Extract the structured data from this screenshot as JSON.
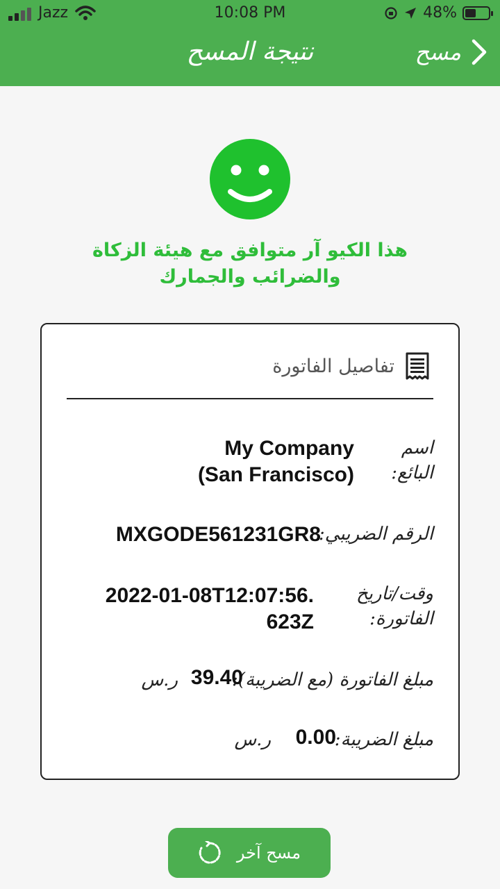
{
  "status_bar": {
    "carrier": "Jazz",
    "time": "10:08 PM",
    "battery": "48%",
    "battery_level": 0.48
  },
  "header": {
    "title": "نتيجة المسح",
    "back_label": "مسح"
  },
  "result": {
    "message_line1": "هذا الكيو آر متوافق مع هيئة الزكاة",
    "message_line2": "والضرائب والجمارك"
  },
  "invoice": {
    "section_title": "تفاصيل الفاتورة",
    "seller_label": "اسم البائع:",
    "seller_value_line1": "My Company",
    "seller_value_line2": "(San Francisco)",
    "tax_number_label": "الرقم الضريبي:",
    "tax_number_value": "MXGODE561231GR8",
    "datetime_label_line1": "وقت/تاريخ",
    "datetime_label_line2": "الفاتورة:",
    "datetime_value_line1": "2022-01-08T12:07:56.",
    "datetime_value_line2": "623Z",
    "amount_label": "مبلغ الفاتورة (مع الضريبة):",
    "amount_value": "39.40",
    "amount_currency": "ر.س",
    "tax_label": "مبلغ الضريبة:",
    "tax_value": "0.00",
    "tax_currency": "ر.س"
  },
  "actions": {
    "scan_again_label": "مسح آخر"
  },
  "colors": {
    "header_green": "#4caf50",
    "success_green": "#2fbd3a"
  }
}
